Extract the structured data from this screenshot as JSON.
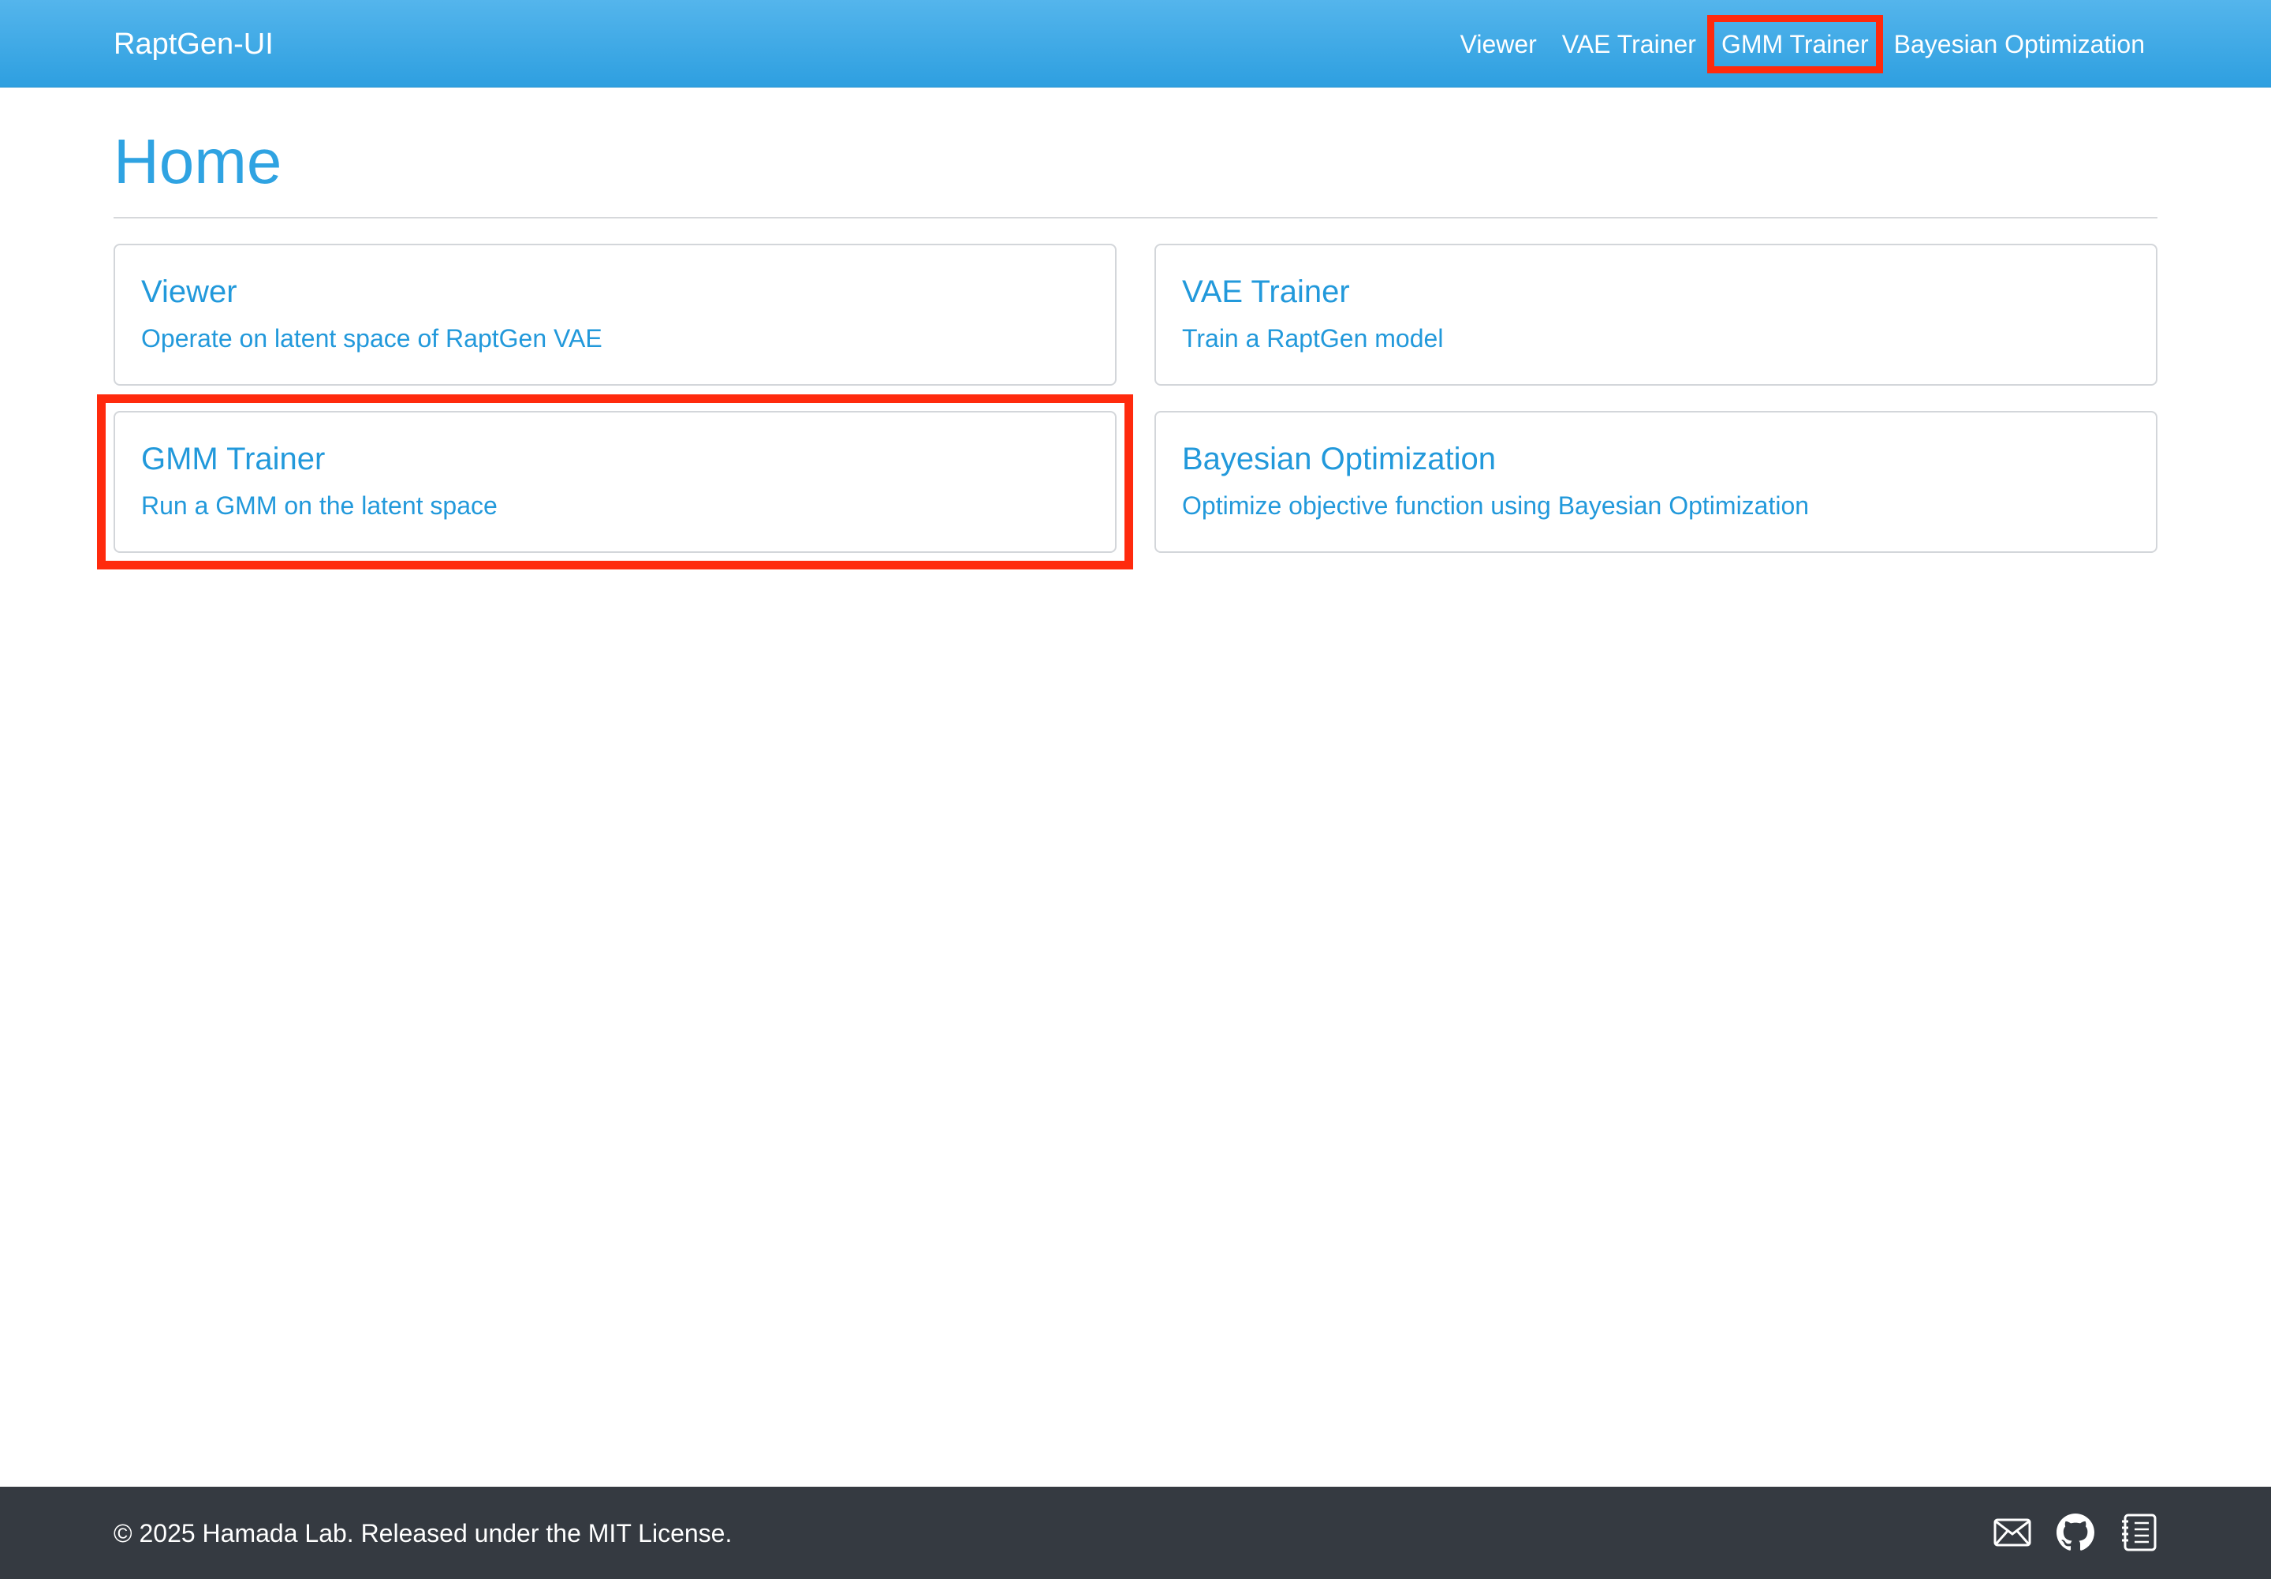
{
  "navbar": {
    "brand": "RaptGen-UI",
    "links": [
      {
        "label": "Viewer"
      },
      {
        "label": "VAE Trainer"
      },
      {
        "label": "GMM Trainer"
      },
      {
        "label": "Bayesian Optimization"
      }
    ]
  },
  "main": {
    "title": "Home",
    "cards": [
      {
        "title": "Viewer",
        "text": "Operate on latent space of RaptGen VAE"
      },
      {
        "title": "VAE Trainer",
        "text": "Train a RaptGen model"
      },
      {
        "title": "GMM Trainer",
        "text": "Run a GMM on the latent space"
      },
      {
        "title": "Bayesian Optimization",
        "text": "Optimize objective function using Bayesian Optimization"
      }
    ]
  },
  "footer": {
    "text": "© 2025 Hamada Lab. Released under the MIT License.",
    "icons": [
      "mail-icon",
      "github-icon",
      "journal-icon"
    ]
  },
  "colors": {
    "navbar": "#2e9fe0",
    "accent": "#2299db",
    "highlight": "#ff2a0d",
    "footer": "#353a41"
  }
}
